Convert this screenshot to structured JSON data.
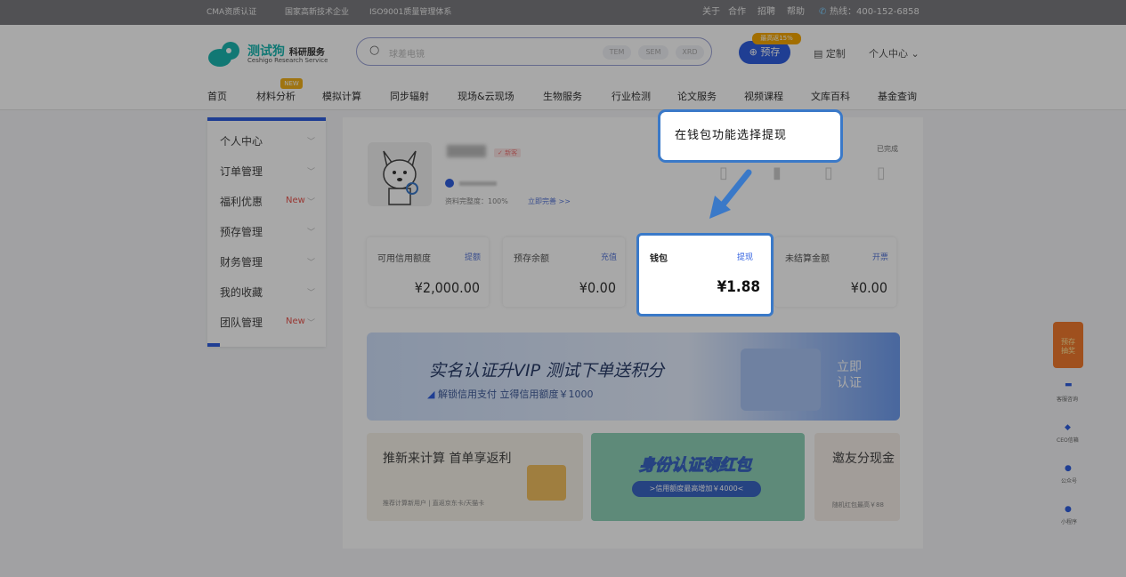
{
  "topbar": {
    "cert1": "CMA资质认证",
    "cert2": "国家高新技术企业",
    "cert3": "ISO9001质量管理体系",
    "links": [
      "关于",
      "合作",
      "招聘",
      "帮助"
    ],
    "hotline": "热线：400-152-6858"
  },
  "header": {
    "brand": "测试狗",
    "brand_suffix": "科研服务",
    "brand_en": "Ceshigo Research Service",
    "search_placeholder": "球差电镜",
    "search_tags": [
      "TEM",
      "SEM",
      "XRD"
    ],
    "prestore_badge": "最高返15%",
    "prestore": "预存",
    "customize": "定制",
    "user_center": "个人中心"
  },
  "nav": {
    "items": [
      "首页",
      "材料分析",
      "模拟计算",
      "同步辐射",
      "现场&云现场",
      "生物服务",
      "行业检测",
      "论文服务",
      "视频课程",
      "文库百科",
      "基金查询"
    ],
    "new_badge": "NEW"
  },
  "sidebar": {
    "items": [
      {
        "label": "个人中心",
        "new": ""
      },
      {
        "label": "订单管理",
        "new": ""
      },
      {
        "label": "福利优惠",
        "new": "New"
      },
      {
        "label": "预存管理",
        "new": ""
      },
      {
        "label": "财务管理",
        "new": ""
      },
      {
        "label": "我的收藏",
        "new": ""
      },
      {
        "label": "团队管理",
        "new": "New"
      }
    ]
  },
  "profile": {
    "tag": "✓ 新客",
    "completeness": "资料完整度：100%",
    "complete_link": "立即完善 >>",
    "status_done": "已完成"
  },
  "cards": [
    {
      "label": "可用信用额度",
      "link": "提额",
      "value": "¥2,000.00"
    },
    {
      "label": "预存余额",
      "link": "充值",
      "value": "¥0.00"
    },
    {
      "label": "钱包",
      "link": "提现",
      "value": "¥1.88"
    },
    {
      "label": "未结算金额",
      "link": "开票",
      "value": "¥0.00"
    }
  ],
  "banner": {
    "title": "实名认证升VIP  测试下单送积分",
    "subtitle": "解锁信用支付  立得信用额度￥1000",
    "button": "立即认证"
  },
  "promos": [
    {
      "title": "推新来计算 首单享返利",
      "sub": "推荐计算新用户 | 直返京东卡/天猫卡"
    },
    {
      "title": "身份认证领红包",
      "sub": ">信用额度最高增加￥4000<"
    },
    {
      "title": "邀友分现金",
      "sub": "随机红包最高￥88"
    }
  ],
  "float": {
    "gift": "预存 抽奖",
    "items": [
      "客服咨询",
      "CEO信箱",
      "公众号",
      "小程序"
    ]
  },
  "tip": "在钱包功能选择提现",
  "colors": {
    "accent": "#2f5fe0",
    "brand": "#1bb7b0",
    "highlight": "#3a79c8",
    "new": "#e8554e"
  }
}
